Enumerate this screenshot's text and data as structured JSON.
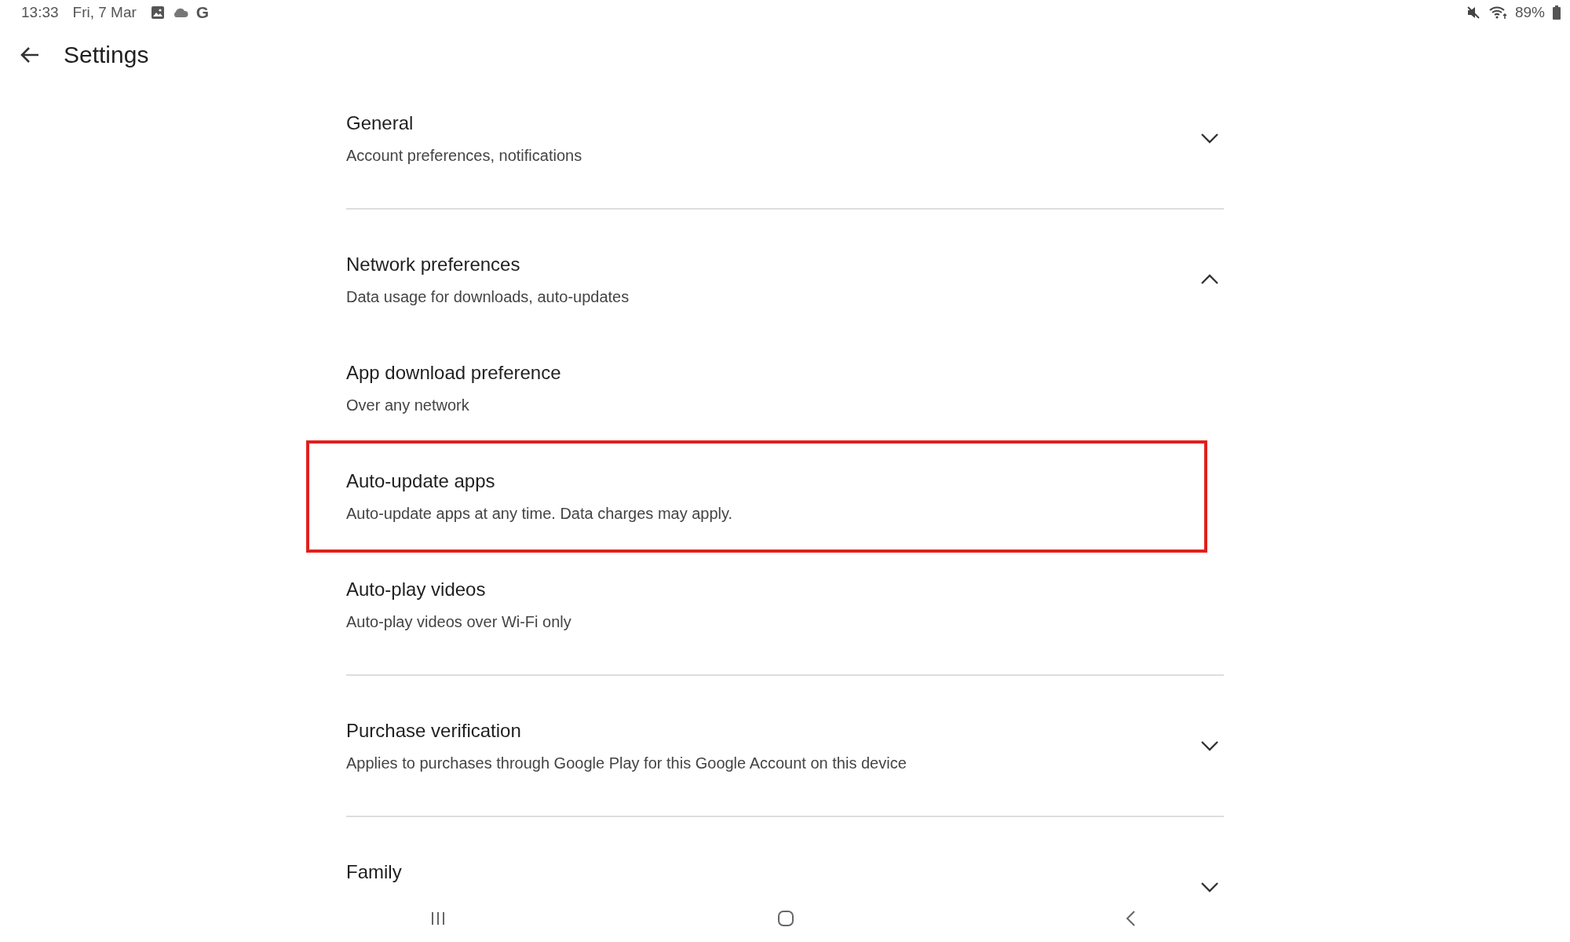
{
  "status_bar": {
    "time": "13:33",
    "date": "Fri, 7 Mar",
    "notification_letter": "G",
    "battery_text": "89%"
  },
  "header": {
    "title": "Settings"
  },
  "sections": [
    {
      "title": "General",
      "subtitle": "Account preferences, notifications",
      "expanded": false
    },
    {
      "title": "Network preferences",
      "subtitle": "Data usage for downloads, auto-updates",
      "expanded": true,
      "children": [
        {
          "title": "App download preference",
          "subtitle": "Over any network",
          "highlighted": false
        },
        {
          "title": "Auto-update apps",
          "subtitle": "Auto-update apps at any time. Data charges may apply.",
          "highlighted": true
        },
        {
          "title": "Auto-play videos",
          "subtitle": "Auto-play videos over Wi-Fi only",
          "highlighted": false
        }
      ]
    },
    {
      "title": "Purchase verification",
      "subtitle": "Applies to purchases through Google Play for this Google Account on this device",
      "expanded": false
    },
    {
      "title": "Family",
      "expanded": false
    }
  ]
}
